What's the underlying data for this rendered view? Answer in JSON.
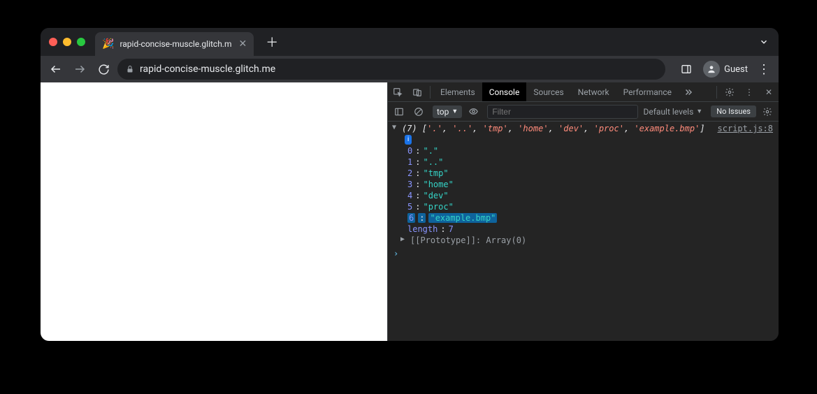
{
  "browser": {
    "tab_title": "rapid-concise-muscle.glitch.m",
    "url_display": "rapid-concise-muscle.glitch.me",
    "guest_label": "Guest"
  },
  "devtools": {
    "tabs": {
      "elements": "Elements",
      "console": "Console",
      "sources": "Sources",
      "network": "Network",
      "performance": "Performance"
    },
    "context": "top",
    "filter_placeholder": "Filter",
    "levels_label": "Default levels",
    "issues_label": "No Issues",
    "source_link": "script.js:8"
  },
  "console": {
    "count": 7,
    "summary_items": [
      "'.'",
      "'..'",
      "'tmp'",
      "'home'",
      "'dev'",
      "'proc'",
      "'example.bmp'"
    ],
    "entries": [
      {
        "index": 0,
        "value": "\".\""
      },
      {
        "index": 1,
        "value": "\"..\""
      },
      {
        "index": 2,
        "value": "\"tmp\""
      },
      {
        "index": 3,
        "value": "\"home\""
      },
      {
        "index": 4,
        "value": "\"dev\""
      },
      {
        "index": 5,
        "value": "\"proc\""
      },
      {
        "index": 6,
        "value": "\"example.bmp\"",
        "highlighted": true
      }
    ],
    "length_label": "length",
    "length_value": 7,
    "prototype_label": "[[Prototype]]",
    "prototype_value": "Array(0)"
  }
}
